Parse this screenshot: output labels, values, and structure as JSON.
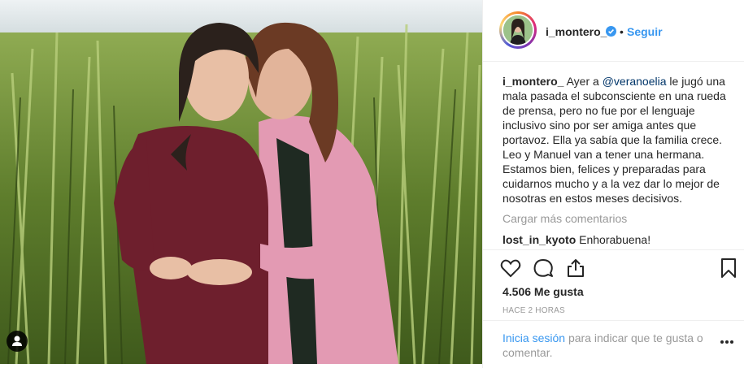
{
  "header": {
    "username": "i_montero_",
    "separator": "•",
    "follow_label": "Seguir"
  },
  "caption": {
    "username": "i_montero_",
    "line1_pre": "Ayer a",
    "mention": "@veranoelia",
    "line1_post": "le jugó una",
    "lines": [
      "mala pasada el subconsciente en una rueda",
      "de prensa, pero no fue por el lenguaje",
      "inclusivo sino por ser amiga antes que",
      "portavoz. Ella ya sabía que la familia crece.",
      "Leo y Manuel van a tener una hermana.",
      "Estamos bien, felices y preparadas para",
      "cuidarnos mucho y a la vez dar lo mejor de",
      "nosotras en estos meses decisivos."
    ]
  },
  "comments": {
    "load_more": "Cargar más comentarios",
    "items": [
      {
        "username": "lost_in_kyoto",
        "text": "Enhorabuena!"
      }
    ]
  },
  "stats": {
    "likes": "4.506 Me gusta",
    "time": "HACE 2 HORAS"
  },
  "login_prompt": {
    "link": "Inicia sesión",
    "rest": "para indicar que te gusta o comentar."
  },
  "icons": {
    "like": "heart-icon",
    "comment": "comment-icon",
    "share": "share-icon",
    "save": "bookmark-icon",
    "more": "more-options-icon",
    "verified": "verified-badge-icon",
    "user_tag": "user-tag-icon"
  },
  "colors": {
    "link": "#3897f0",
    "text": "#262626",
    "muted": "#999999",
    "verified": "#3897f0",
    "mention": "#003569"
  }
}
